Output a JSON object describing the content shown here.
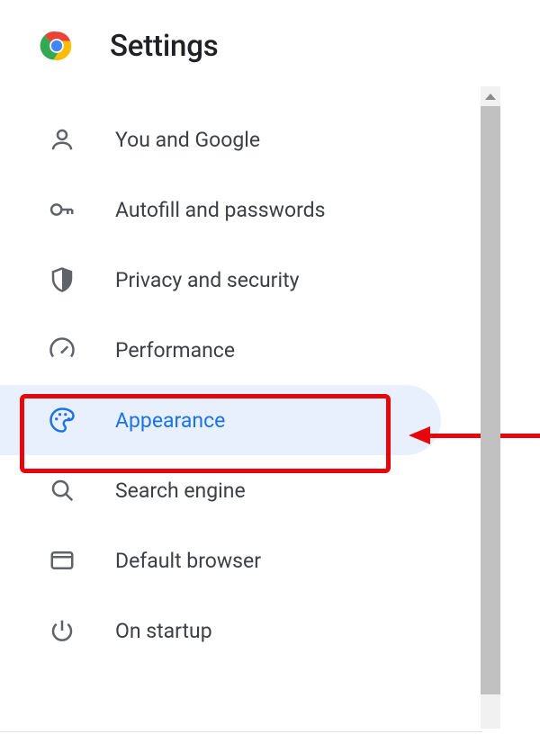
{
  "header": {
    "title": "Settings"
  },
  "nav": {
    "items": [
      {
        "id": "you-and-google",
        "label": "You and Google",
        "icon": "person-icon",
        "selected": false
      },
      {
        "id": "autofill",
        "label": "Autofill and passwords",
        "icon": "key-icon",
        "selected": false
      },
      {
        "id": "privacy",
        "label": "Privacy and security",
        "icon": "shield-icon",
        "selected": false
      },
      {
        "id": "performance",
        "label": "Performance",
        "icon": "speedometer-icon",
        "selected": false
      },
      {
        "id": "appearance",
        "label": "Appearance",
        "icon": "palette-icon",
        "selected": true
      },
      {
        "id": "search-engine",
        "label": "Search engine",
        "icon": "search-icon",
        "selected": false
      },
      {
        "id": "default-browser",
        "label": "Default browser",
        "icon": "browser-icon",
        "selected": false
      },
      {
        "id": "on-startup",
        "label": "On startup",
        "icon": "power-icon",
        "selected": false
      }
    ]
  },
  "annotation": {
    "highlighted_item": "appearance",
    "arrow_color": "#e7060b"
  }
}
